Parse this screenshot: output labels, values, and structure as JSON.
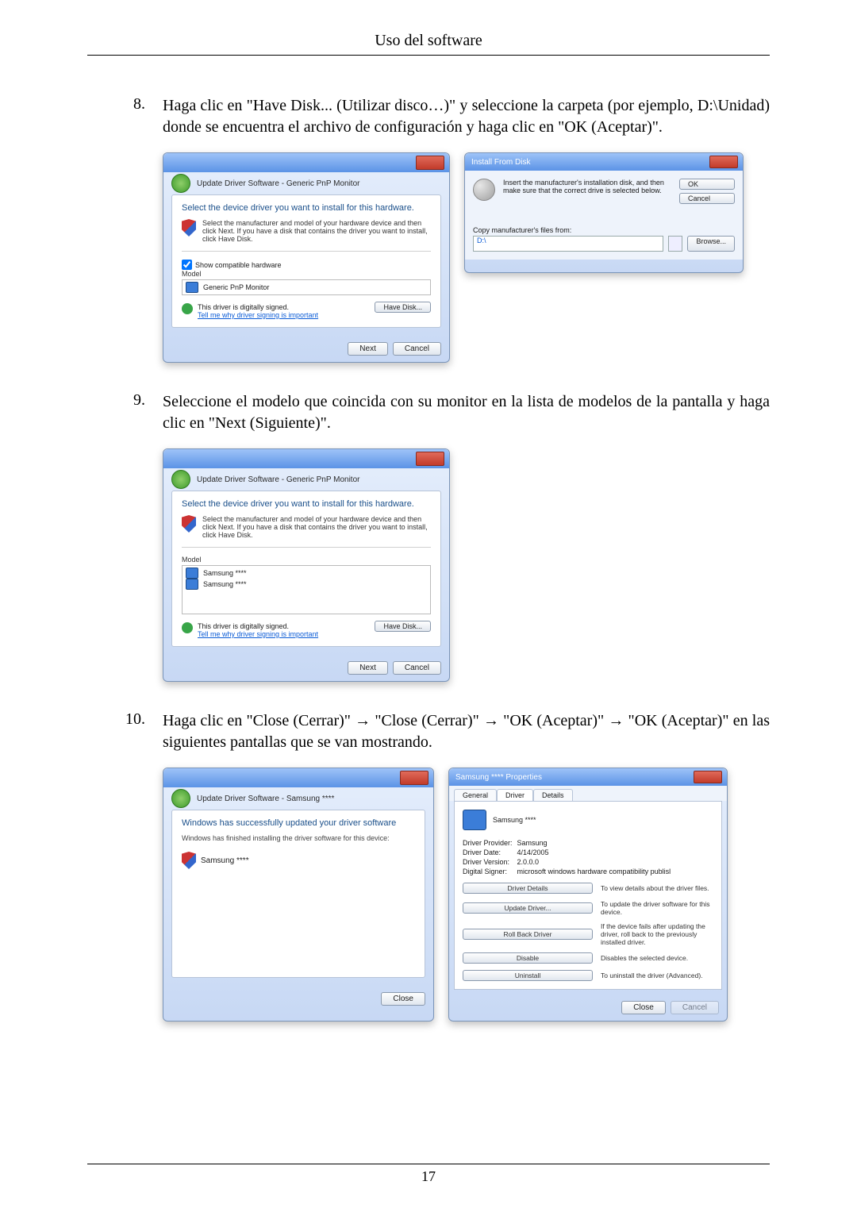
{
  "page": {
    "header": "Uso del software",
    "number": "17"
  },
  "steps": {
    "s8": {
      "num": "8.",
      "text": "Haga clic en \"Have Disk... (Utilizar disco…)\" y seleccione la carpeta (por ejemplo, D:\\Unidad) donde se encuentra el archivo de configuración y haga clic en \"OK (Aceptar)\"."
    },
    "s9": {
      "num": "9.",
      "text": "Seleccione el modelo que coincida con su monitor en la lista de modelos de la pantalla y haga clic en \"Next (Siguiente)\"."
    },
    "s10": {
      "num": "10.",
      "text": "Haga clic en \"Close (Cerrar)\" → \"Close (Cerrar)\" → \"OK (Aceptar)\" → \"OK (Aceptar)\" en las siguientes pantallas que se van mostrando."
    }
  },
  "dlgUpdate": {
    "crumb": "Update Driver Software - Generic PnP Monitor",
    "heading": "Select the device driver you want to install for this hardware.",
    "note": "Select the manufacturer and model of your hardware device and then click Next. If you have a disk that contains the driver you want to install, click Have Disk.",
    "chk": "Show compatible hardware",
    "model_lbl": "Model",
    "model_item": "Generic PnP Monitor",
    "signed": "This driver is digitally signed.",
    "tell": "Tell me why driver signing is important",
    "btn_havedisk": "Have Disk...",
    "btn_next": "Next",
    "btn_cancel": "Cancel"
  },
  "dlgIFD": {
    "title": "Install From Disk",
    "msg": "Insert the manufacturer's installation disk, and then make sure that the correct drive is selected below.",
    "ok": "OK",
    "cancel": "Cancel",
    "copy": "Copy manufacturer's files from:",
    "path": "D:\\",
    "browse": "Browse..."
  },
  "dlgSelect": {
    "crumb": "Update Driver Software - Generic PnP Monitor",
    "heading": "Select the device driver you want to install for this hardware.",
    "note": "Select the manufacturer and model of your hardware device and then click Next. If you have a disk that contains the driver you want to install, click Have Disk.",
    "model_lbl": "Model",
    "m1": "Samsung ****",
    "m2": "Samsung ****",
    "signed": "This driver is digitally signed.",
    "tell": "Tell me why driver signing is important",
    "btn_havedisk": "Have Disk...",
    "btn_next": "Next",
    "btn_cancel": "Cancel"
  },
  "dlgDone": {
    "crumb": "Update Driver Software - Samsung ****",
    "heading": "Windows has successfully updated your driver software",
    "sub": "Windows has finished installing the driver software for this device:",
    "dev": "Samsung ****",
    "close": "Close"
  },
  "dlgProp": {
    "title": "Samsung **** Properties",
    "tab_general": "General",
    "tab_driver": "Driver",
    "tab_details": "Details",
    "device": "Samsung ****",
    "lbl_provider": "Driver Provider:",
    "val_provider": "Samsung",
    "lbl_date": "Driver Date:",
    "val_date": "4/14/2005",
    "lbl_ver": "Driver Version:",
    "val_ver": "2.0.0.0",
    "lbl_signer": "Digital Signer:",
    "val_signer": "microsoft windows hardware compatibility publisl",
    "btn_details": "Driver Details",
    "txt_details": "To view details about the driver files.",
    "btn_update": "Update Driver...",
    "txt_update": "To update the driver software for this device.",
    "btn_rollback": "Roll Back Driver",
    "txt_rollback": "If the device fails after updating the driver, roll back to the previously installed driver.",
    "btn_disable": "Disable",
    "txt_disable": "Disables the selected device.",
    "btn_uninstall": "Uninstall",
    "txt_uninstall": "To uninstall the driver (Advanced).",
    "close": "Close",
    "cancel": "Cancel"
  }
}
